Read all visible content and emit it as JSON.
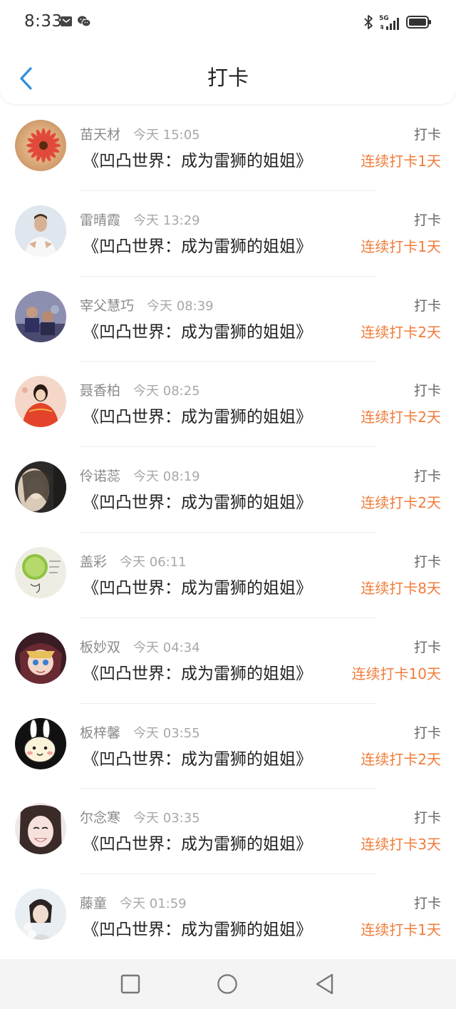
{
  "status_bar": {
    "time": "8:33",
    "left_icons": [
      "message-icon",
      "wechat-icon"
    ],
    "right_icons": [
      "bluetooth-icon",
      "signal-5g-icon",
      "battery-icon"
    ],
    "network_label": "5G"
  },
  "header": {
    "title": "打卡",
    "back_icon": "back-arrow-icon",
    "accent_color": "#2a8fe0"
  },
  "records": [
    {
      "name": "苗天材",
      "time": "今天 15:05",
      "book": "《凹凸世界：成为雷狮的姐姐》",
      "action": "打卡",
      "streak": "连续打卡1天",
      "avatar": "flower"
    },
    {
      "name": "雷晴霞",
      "time": "今天 13:29",
      "book": "《凹凸世界：成为雷狮的姐姐》",
      "action": "打卡",
      "streak": "连续打卡1天",
      "avatar": "man-white-shirt"
    },
    {
      "name": "宰父慧巧",
      "time": "今天 08:39",
      "book": "《凹凸世界：成为雷狮的姐姐》",
      "action": "打卡",
      "streak": "连续打卡2天",
      "avatar": "group-photo"
    },
    {
      "name": "聂香柏",
      "time": "今天 08:25",
      "book": "《凹凸世界：成为雷狮的姐姐》",
      "action": "打卡",
      "streak": "连续打卡2天",
      "avatar": "doll-red-dress"
    },
    {
      "name": "伶诺蕊",
      "time": "今天 08:19",
      "book": "《凹凸世界：成为雷狮的姐姐》",
      "action": "打卡",
      "streak": "连续打卡2天",
      "avatar": "woman-portrait"
    },
    {
      "name": "盖彩",
      "time": "今天 06:11",
      "book": "《凹凸世界：成为雷狮的姐姐》",
      "action": "打卡",
      "streak": "连续打卡8天",
      "avatar": "lime-drawing"
    },
    {
      "name": "板妙双",
      "time": "今天 04:34",
      "book": "《凹凸世界：成为雷狮的姐姐》",
      "action": "打卡",
      "streak": "连续打卡10天",
      "avatar": "anime-girl"
    },
    {
      "name": "板梓馨",
      "time": "今天 03:55",
      "book": "《凹凸世界：成为雷狮的姐姐》",
      "action": "打卡",
      "streak": "连续打卡2天",
      "avatar": "cartoon-bunny"
    },
    {
      "name": "尔念寒",
      "time": "今天 03:35",
      "book": "《凹凸世界：成为雷狮的姐姐》",
      "action": "打卡",
      "streak": "连续打卡3天",
      "avatar": "smiling-girl"
    },
    {
      "name": "藤童",
      "time": "今天 01:59",
      "book": "《凹凸世界：成为雷狮的姐姐》",
      "action": "打卡",
      "streak": "连续打卡1天",
      "avatar": "girl-with-flowers"
    }
  ],
  "colors": {
    "streak": "#f07c3a",
    "name": "#8a8a8a",
    "time": "#a8a8a8",
    "book": "#222222"
  },
  "system_nav": {
    "buttons": [
      "recent-apps-icon",
      "home-icon",
      "back-icon"
    ]
  }
}
